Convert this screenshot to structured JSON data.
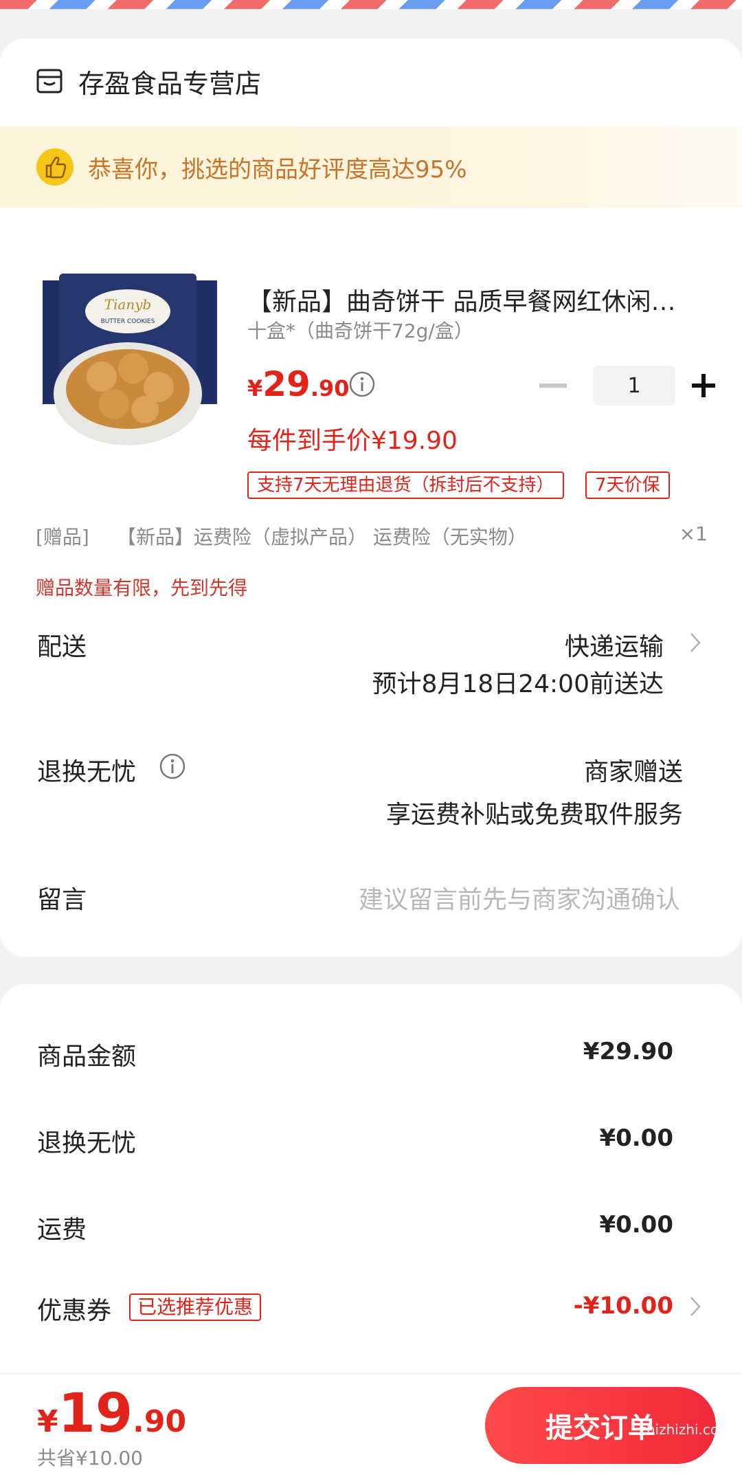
{
  "store": {
    "name": "存盈食品专营店"
  },
  "banner": {
    "text": "恭喜你，挑选的商品好评度高达95%"
  },
  "product": {
    "title": "【新品】曲奇饼干 品质早餐网红休闲零食",
    "spec": "十盒*（曲奇饼干72g/盒）",
    "price_symbol": "¥",
    "price_int": "29",
    "price_dec": ".90",
    "quantity": "1",
    "deal_price": "每件到手价¥19.90",
    "tags": [
      "支持7天无理由退货（拆封后不支持）",
      "7天价保"
    ]
  },
  "gift": {
    "label": "[赠品]",
    "text": "【新品】运费险（虚拟产品） 运费险（无实物）",
    "qty": "×1",
    "note": "赠品数量有限，先到先得"
  },
  "delivery": {
    "label": "配送",
    "method": "快递运输",
    "eta": "预计8月18日24:00前送达"
  },
  "returns": {
    "label": "退换无忧",
    "value": "商家赠送",
    "desc": "享运费补贴或免费取件服务"
  },
  "message": {
    "label": "留言",
    "placeholder": "建议留言前先与商家沟通确认"
  },
  "summary": {
    "goods_label": "商品金额",
    "goods_value": "¥29.90",
    "returns_label": "退换无忧",
    "returns_value": "¥0.00",
    "shipping_label": "运费",
    "shipping_value": "¥0.00",
    "coupon_label": "优惠券",
    "coupon_tag": "已选推荐优惠",
    "coupon_value": "-¥10.00"
  },
  "bottom": {
    "total_symbol": "¥",
    "total_int": "19",
    "total_dec": ".90",
    "saved": "共省¥10.00",
    "submit_label": "提交订单",
    "watermark": "zhizhizhi.com"
  },
  "colors": {
    "accent": "#e2231a",
    "banner_text": "#c5742a",
    "muted": "#8a8a8a"
  }
}
